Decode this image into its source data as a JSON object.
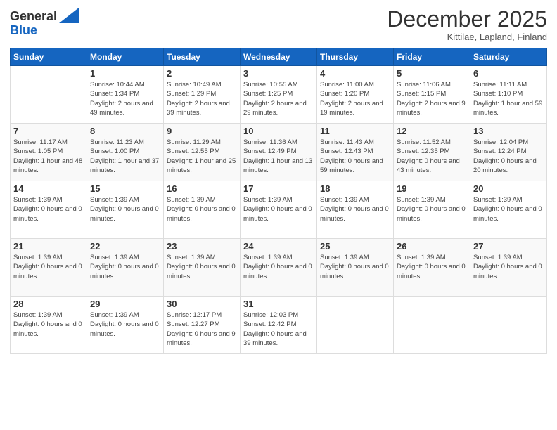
{
  "logo": {
    "line1": "General",
    "line2": "Blue"
  },
  "title": "December 2025",
  "subtitle": "Kittilae, Lapland, Finland",
  "days_of_week": [
    "Sunday",
    "Monday",
    "Tuesday",
    "Wednesday",
    "Thursday",
    "Friday",
    "Saturday"
  ],
  "weeks": [
    [
      {
        "day": "",
        "info": ""
      },
      {
        "day": "1",
        "info": "Sunrise: 10:44 AM\nSunset: 1:34 PM\nDaylight: 2 hours\nand 49 minutes."
      },
      {
        "day": "2",
        "info": "Sunrise: 10:49 AM\nSunset: 1:29 PM\nDaylight: 2 hours\nand 39 minutes."
      },
      {
        "day": "3",
        "info": "Sunrise: 10:55 AM\nSunset: 1:25 PM\nDaylight: 2 hours\nand 29 minutes."
      },
      {
        "day": "4",
        "info": "Sunrise: 11:00 AM\nSunset: 1:20 PM\nDaylight: 2 hours\nand 19 minutes."
      },
      {
        "day": "5",
        "info": "Sunrise: 11:06 AM\nSunset: 1:15 PM\nDaylight: 2 hours\nand 9 minutes."
      },
      {
        "day": "6",
        "info": "Sunrise: 11:11 AM\nSunset: 1:10 PM\nDaylight: 1 hour and\n59 minutes."
      }
    ],
    [
      {
        "day": "7",
        "info": "Sunrise: 11:17 AM\nSunset: 1:05 PM\nDaylight: 1 hour and\n48 minutes."
      },
      {
        "day": "8",
        "info": "Sunrise: 11:23 AM\nSunset: 1:00 PM\nDaylight: 1 hour and\n37 minutes."
      },
      {
        "day": "9",
        "info": "Sunrise: 11:29 AM\nSunset: 12:55 PM\nDaylight: 1 hour and\n25 minutes."
      },
      {
        "day": "10",
        "info": "Sunrise: 11:36 AM\nSunset: 12:49 PM\nDaylight: 1 hour and\n13 minutes."
      },
      {
        "day": "11",
        "info": "Sunrise: 11:43 AM\nSunset: 12:43 PM\nDaylight: 0 hours\nand 59 minutes."
      },
      {
        "day": "12",
        "info": "Sunrise: 11:52 AM\nSunset: 12:35 PM\nDaylight: 0 hours\nand 43 minutes."
      },
      {
        "day": "13",
        "info": "Sunrise: 12:04 PM\nSunset: 12:24 PM\nDaylight: 0 hours\nand 20 minutes."
      }
    ],
    [
      {
        "day": "14",
        "info": "Sunset: 1:39 AM\nDaylight: 0 hours\nand 0 minutes."
      },
      {
        "day": "15",
        "info": "Sunset: 1:39 AM\nDaylight: 0 hours\nand 0 minutes."
      },
      {
        "day": "16",
        "info": "Sunset: 1:39 AM\nDaylight: 0 hours\nand 0 minutes."
      },
      {
        "day": "17",
        "info": "Sunset: 1:39 AM\nDaylight: 0 hours\nand 0 minutes."
      },
      {
        "day": "18",
        "info": "Sunset: 1:39 AM\nDaylight: 0 hours\nand 0 minutes."
      },
      {
        "day": "19",
        "info": "Sunset: 1:39 AM\nDaylight: 0 hours\nand 0 minutes."
      },
      {
        "day": "20",
        "info": "Sunset: 1:39 AM\nDaylight: 0 hours\nand 0 minutes."
      }
    ],
    [
      {
        "day": "21",
        "info": "Sunset: 1:39 AM\nDaylight: 0 hours\nand 0 minutes."
      },
      {
        "day": "22",
        "info": "Sunset: 1:39 AM\nDaylight: 0 hours\nand 0 minutes."
      },
      {
        "day": "23",
        "info": "Sunset: 1:39 AM\nDaylight: 0 hours\nand 0 minutes."
      },
      {
        "day": "24",
        "info": "Sunset: 1:39 AM\nDaylight: 0 hours\nand 0 minutes."
      },
      {
        "day": "25",
        "info": "Sunset: 1:39 AM\nDaylight: 0 hours\nand 0 minutes."
      },
      {
        "day": "26",
        "info": "Sunset: 1:39 AM\nDaylight: 0 hours\nand 0 minutes."
      },
      {
        "day": "27",
        "info": "Sunset: 1:39 AM\nDaylight: 0 hours\nand 0 minutes."
      }
    ],
    [
      {
        "day": "28",
        "info": "Sunset: 1:39 AM\nDaylight: 0 hours\nand 0 minutes."
      },
      {
        "day": "29",
        "info": "Sunset: 1:39 AM\nDaylight: 0 hours\nand 0 minutes."
      },
      {
        "day": "30",
        "info": "Sunrise: 12:17 PM\nSunset: 12:27 PM\nDaylight: 0 hours\nand 9 minutes."
      },
      {
        "day": "31",
        "info": "Sunrise: 12:03 PM\nSunset: 12:42 PM\nDaylight: 0 hours\nand 39 minutes."
      },
      {
        "day": "",
        "info": ""
      },
      {
        "day": "",
        "info": ""
      },
      {
        "day": "",
        "info": ""
      }
    ]
  ]
}
